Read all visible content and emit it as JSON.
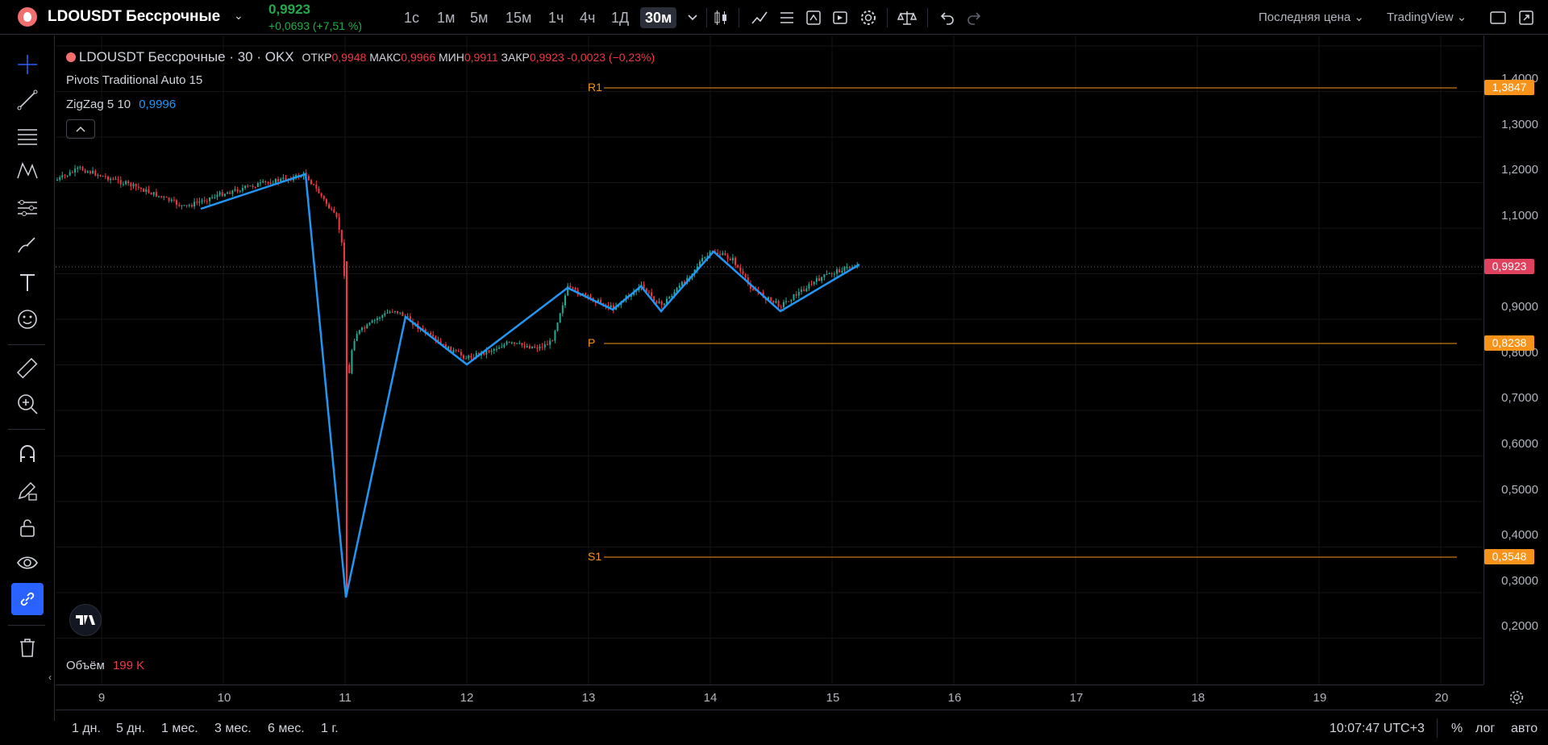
{
  "header": {
    "symbol": "LDOUSDT Бессрочные",
    "last_price": "0,9923",
    "change": "+0,0693 (+7,51 %)",
    "intervals": [
      "1с",
      "1м",
      "5м",
      "15м",
      "1ч",
      "4ч",
      "1Д",
      "30м"
    ],
    "price_type": "Последняя цена",
    "platform": "TradingView"
  },
  "legend": {
    "title": "LDOUSDT Бессрочные · 30 · OKX",
    "ohlc": [
      {
        "label": "ОТКР",
        "value": "0,9948"
      },
      {
        "label": "МАКС",
        "value": "0,9966"
      },
      {
        "label": "МИН",
        "value": "0,9911"
      },
      {
        "label": "ЗАКР",
        "value": "0,9923"
      }
    ],
    "change": "-0,0023 (−0,23%)",
    "pivots": "Pivots Traditional Auto 15",
    "zigzag_name": "ZigZag 5 10",
    "zigzag_value": "0,9996",
    "volume_label": "Объём",
    "volume_value": "199 K"
  },
  "pivots": {
    "r1_tag": "R1",
    "r1_value": "1,3847",
    "p_tag": "P",
    "p_value": "0,8238",
    "s1_tag": "S1",
    "s1_value": "0,3548",
    "last_value": "0,9923"
  },
  "y_ticks": [
    "1,4000",
    "1,3000",
    "1,2000",
    "1,1000",
    "0,9000",
    "0,8000",
    "0,7000",
    "0,6000",
    "0,5000",
    "0,4000",
    "0,3000",
    "0,2000"
  ],
  "x_ticks": [
    "9",
    "10",
    "11",
    "12",
    "13",
    "14",
    "15",
    "16",
    "17",
    "18",
    "19",
    "20"
  ],
  "ranges": [
    "1 дн.",
    "5 дн.",
    "1 мес.",
    "3 мес.",
    "6 мес.",
    "1 г."
  ],
  "footer": {
    "time": "10:07:47 UTC+3",
    "percent": "%",
    "log": "лог",
    "auto": "авто"
  },
  "colors": {
    "up": "#22ab94",
    "down": "#f23645",
    "pivot": "#f7931a",
    "zigzag": "#2196f3",
    "price_label": "#e0415e",
    "background": "#000000"
  }
}
